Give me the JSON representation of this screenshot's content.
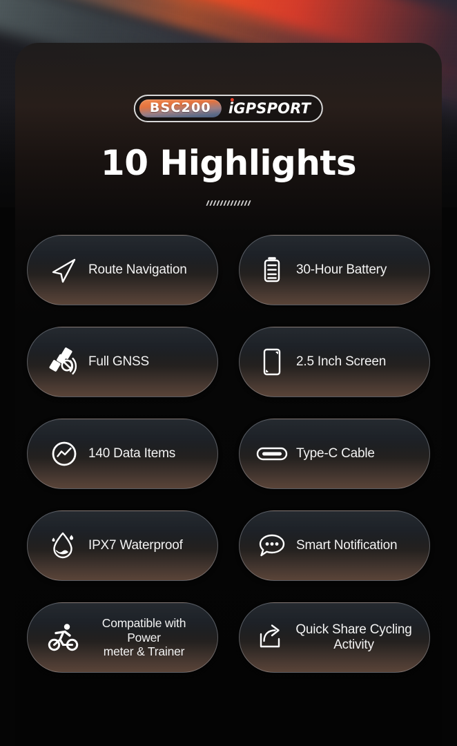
{
  "product": {
    "model_badge": "BSC200",
    "brand": "iGPSPORT"
  },
  "header": {
    "title": "10 Highlights",
    "divider_marks": 13
  },
  "colors": {
    "page_background": "#050505",
    "card_background": "#0a0908",
    "pill_top": "#1b2026",
    "pill_bottom": "#5a4438",
    "pill_border": "#bec3cd",
    "text": "#f2f2f2",
    "logo_dot": "#e8402a",
    "logo_pill_start": "#f08a4e",
    "logo_pill_end": "#4a5d7d",
    "background_streak_orange": "#ff7828"
  },
  "features": [
    {
      "id": "route-navigation",
      "label": "Route Navigation",
      "icon": "navigation-arrow-icon",
      "align": "left",
      "size": "normal"
    },
    {
      "id": "battery",
      "label": "30-Hour Battery",
      "icon": "battery-icon",
      "align": "left",
      "size": "normal"
    },
    {
      "id": "full-gnss",
      "label": "Full GNSS",
      "icon": "satellite-icon",
      "align": "left",
      "size": "normal"
    },
    {
      "id": "screen-size",
      "label": "2.5 Inch Screen",
      "icon": "screen-icon",
      "align": "left",
      "size": "normal"
    },
    {
      "id": "data-items",
      "label": "140 Data Items",
      "icon": "data-chart-icon",
      "align": "left",
      "size": "normal"
    },
    {
      "id": "type-c-cable",
      "label": "Type-C Cable",
      "icon": "usb-type-c-icon",
      "align": "left",
      "size": "normal"
    },
    {
      "id": "waterproof",
      "label": "IPX7 Waterproof",
      "icon": "water-drop-icon",
      "align": "left",
      "size": "normal"
    },
    {
      "id": "smart-notification",
      "label": "Smart Notification",
      "icon": "speech-bubble-icon",
      "align": "left",
      "size": "normal"
    },
    {
      "id": "power-meter",
      "label": "Compatible with Power\nmeter & Trainer",
      "icon": "cyclist-icon",
      "align": "center",
      "size": "small"
    },
    {
      "id": "quick-share",
      "label": "Quick Share Cycling\nActivity",
      "icon": "share-icon",
      "align": "center",
      "size": "normal"
    }
  ]
}
